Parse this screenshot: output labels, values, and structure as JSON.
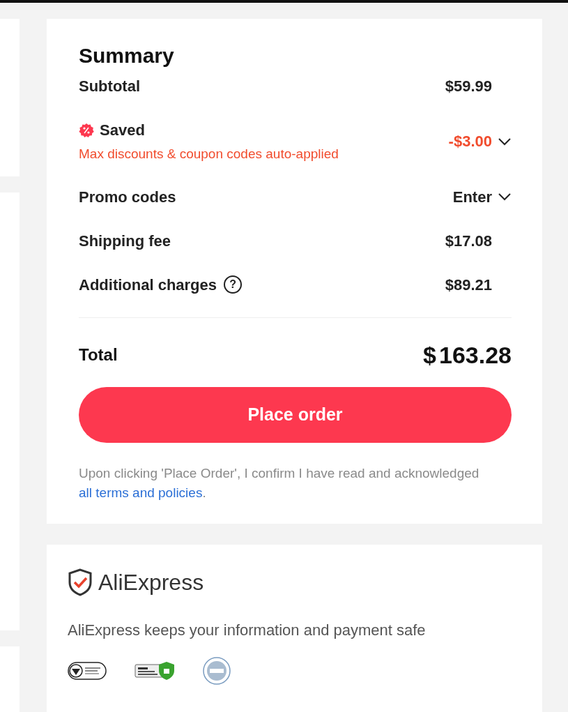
{
  "summary": {
    "title": "Summary",
    "rows": [
      {
        "kind": "amount",
        "label": "Subtotal",
        "value": "$59.99"
      },
      {
        "kind": "saved",
        "label": "Saved",
        "note": "Max discounts & coupon codes auto-applied",
        "value": "-$3.00",
        "expanded": false
      },
      {
        "kind": "dropdown",
        "label": "Promo codes",
        "value": "Enter",
        "expanded": false
      },
      {
        "kind": "amount",
        "label": "Shipping fee",
        "value": "$17.08"
      },
      {
        "kind": "info",
        "label": "Additional charges",
        "info_icon": "?",
        "value": "$89.21"
      }
    ],
    "total": {
      "label": "Total",
      "currency": "$",
      "value": "163.28"
    },
    "button": "Place order",
    "disclaimer": "Upon clicking 'Place Order', I confirm I have read and acknowledged ",
    "link": "all terms and policies",
    "disclaimer_end": "."
  },
  "security": {
    "brand": "AliExpress",
    "text": "AliExpress keeps your information and payment safe"
  }
}
